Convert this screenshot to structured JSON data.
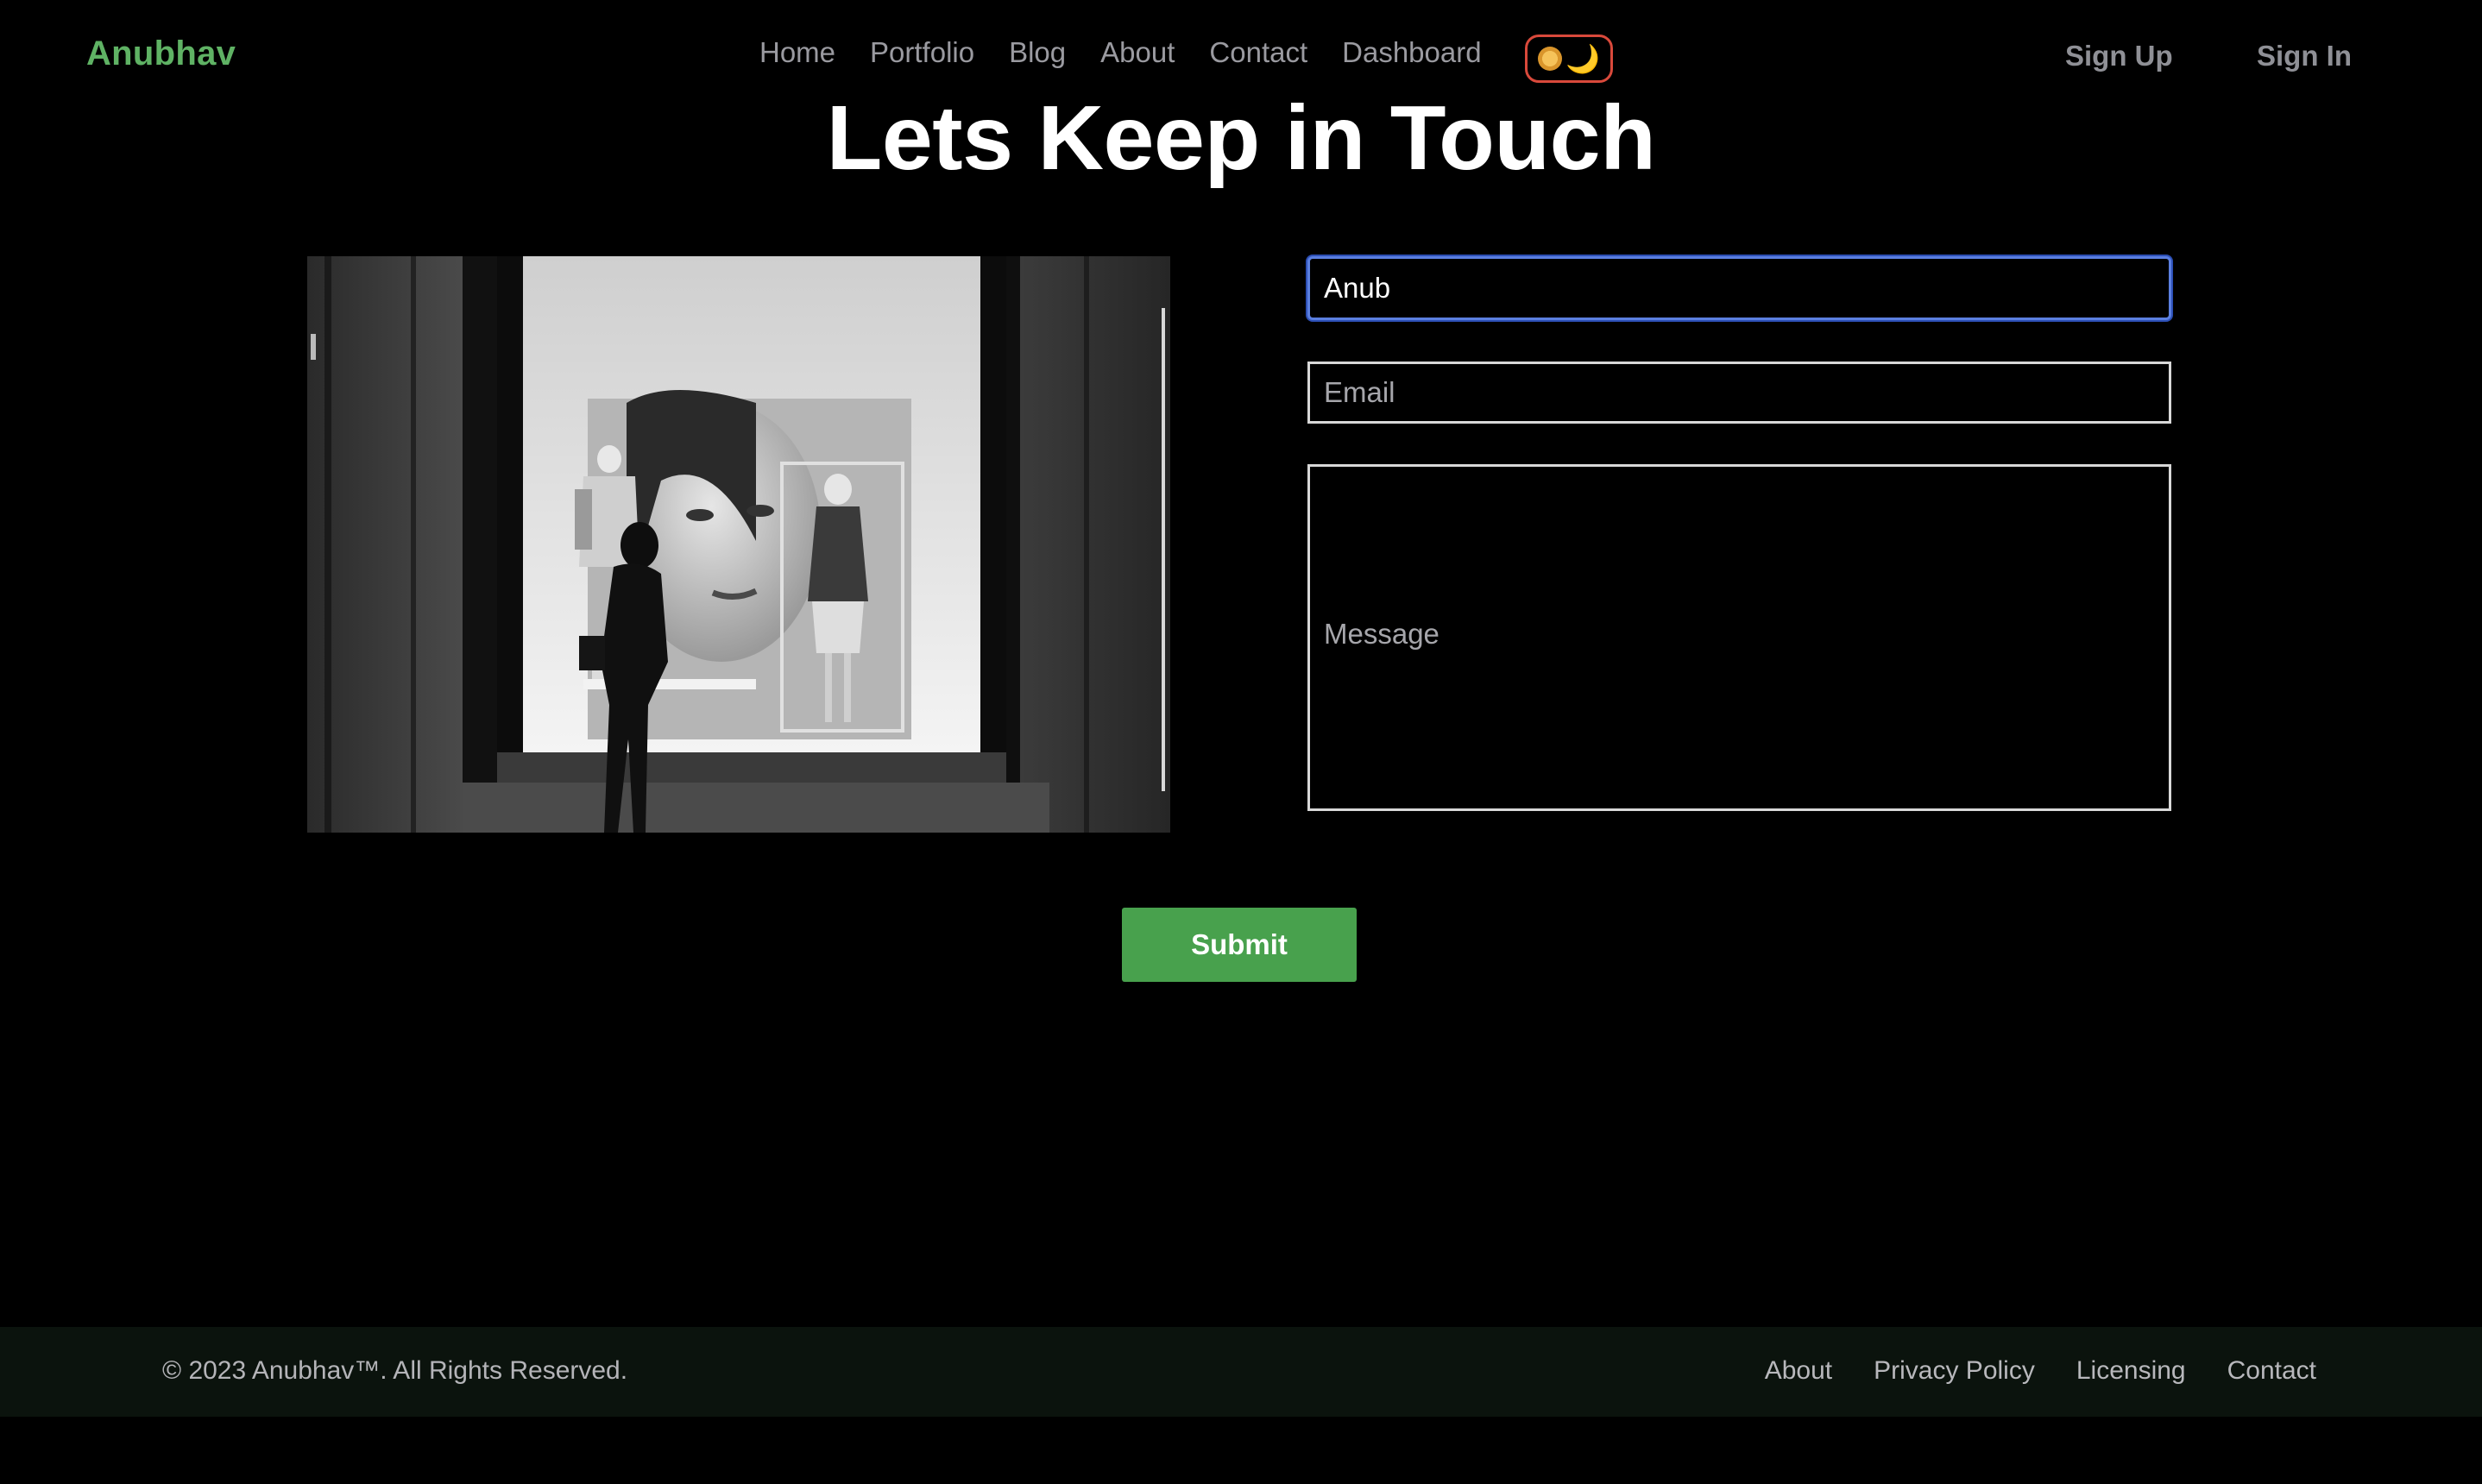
{
  "nav": {
    "brand": "Anubhav",
    "links": [
      {
        "label": "Home"
      },
      {
        "label": "Portfolio"
      },
      {
        "label": "Blog"
      },
      {
        "label": "About"
      },
      {
        "label": "Contact"
      },
      {
        "label": "Dashboard"
      }
    ],
    "theme_toggle": {
      "icons": [
        "sun-icon",
        "moon-icon"
      ],
      "moon_glyph": "🌙"
    },
    "sign_up": "Sign Up",
    "sign_in": "Sign In"
  },
  "page": {
    "title": "Lets Keep in Touch"
  },
  "form": {
    "name_value": "Anub",
    "email_placeholder": "Email",
    "message_placeholder": "Message",
    "submit_label": "Submit"
  },
  "footer": {
    "copyright": "© 2023 Anubhav™. All Rights Reserved.",
    "links": [
      {
        "label": "About"
      },
      {
        "label": "Privacy Policy"
      },
      {
        "label": "Licensing"
      },
      {
        "label": "Contact"
      }
    ]
  },
  "colors": {
    "background": "#000000",
    "brand": "#5fb264",
    "submit": "#48a14d",
    "toggle_border": "#d9493b",
    "focus_ring": "#5b7fe0",
    "footer_bg": "#0b130d"
  }
}
